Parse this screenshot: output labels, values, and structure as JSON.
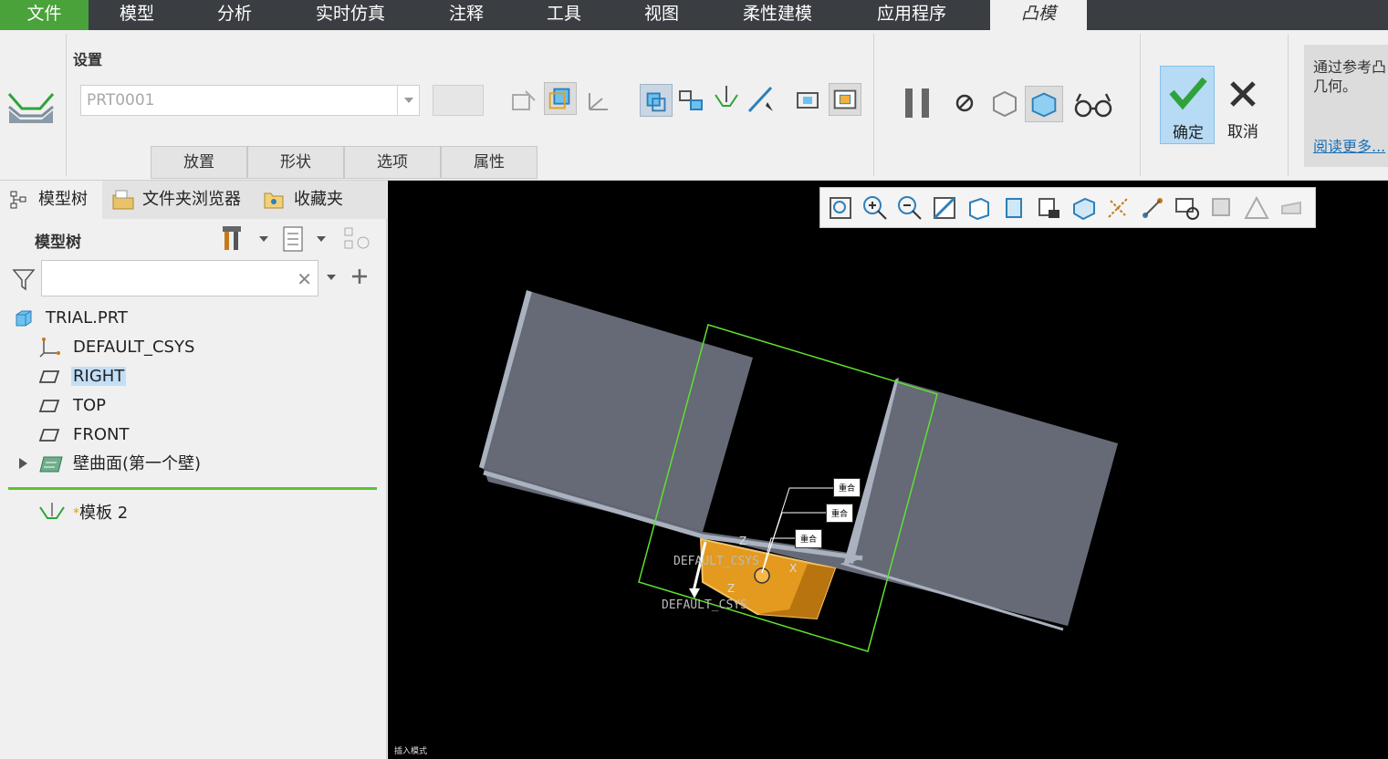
{
  "menubar": {
    "tabs": [
      "文件",
      "模型",
      "分析",
      "实时仿真",
      "注释",
      "工具",
      "视图",
      "柔性建模",
      "应用程序",
      "凸模"
    ]
  },
  "ribbon": {
    "settings_label": "设置",
    "part_combo_value": "PRT0001",
    "subtabs": [
      "放置",
      "形状",
      "选项",
      "属性"
    ],
    "ok_label": "确定",
    "cancel_label": "取消",
    "help_text": "通过参考凸\n几何。",
    "help_link": "阅读更多..."
  },
  "panel": {
    "tabs": [
      "模型树",
      "文件夹浏览器",
      "收藏夹"
    ],
    "tree_title": "模型树",
    "filter_value": "",
    "items": [
      {
        "label": "TRIAL.PRT",
        "icon": "part-icon"
      },
      {
        "label": "DEFAULT_CSYS",
        "icon": "csys-icon"
      },
      {
        "label": "RIGHT",
        "icon": "datum-plane-icon",
        "selected": true
      },
      {
        "label": "TOP",
        "icon": "datum-plane-icon"
      },
      {
        "label": "FRONT",
        "icon": "datum-plane-icon"
      },
      {
        "label": "壁曲面(第一个壁)",
        "icon": "wall-icon"
      }
    ],
    "insert_item": {
      "star": "*",
      "label": "模板 2"
    }
  },
  "viewport": {
    "constraint_labels": [
      "重合",
      "重合",
      "重合"
    ],
    "csys_label_1": "DEFAULT_CSYS",
    "csys_label_2": "DEFAULT_CSYS",
    "axis_z": "Z",
    "axis_x": "X",
    "status": "插入模式"
  },
  "colors": {
    "menubar": "#3a3d41",
    "file_tab": "#4aa23a",
    "ok_button": "#b7dbf5",
    "sheet_metal": "#656a76",
    "punch_orange": "#e39a1e",
    "placement_box": "#5fe030"
  }
}
